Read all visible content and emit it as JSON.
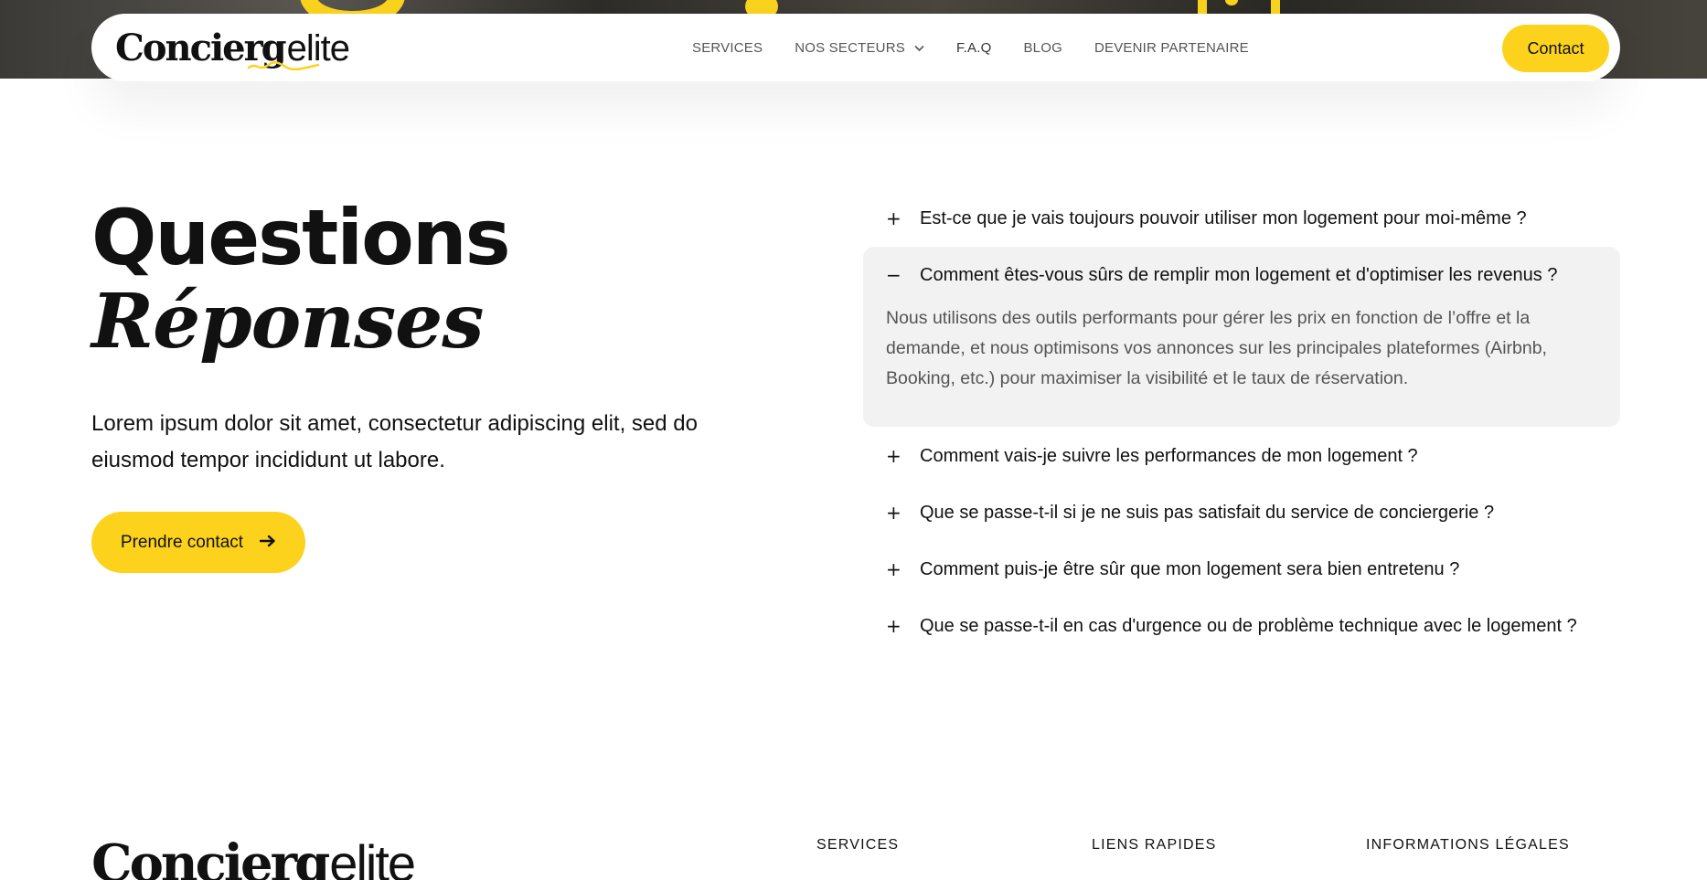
{
  "colors": {
    "accent": "#fcd21d",
    "open_panel_bg": "#f2f2f2",
    "text": "#111111",
    "muted": "#555555"
  },
  "brand": {
    "part1": "Concierg",
    "part2": "elite"
  },
  "nav": {
    "items": [
      {
        "label": "SERVICES"
      },
      {
        "label": "NOS SECTEURS"
      },
      {
        "label": "F.A.Q"
      },
      {
        "label": "BLOG"
      },
      {
        "label": "DEVENIR PARTENAIRE"
      }
    ],
    "contact_label": "Contact"
  },
  "faq": {
    "title_line1": "Questions",
    "title_line2": "Réponses",
    "lead": "Lorem ipsum dolor sit amet, consectetur adipiscing elit, sed do eiusmod tempor incididunt ut labore.",
    "cta_label": "Prendre contact",
    "items": [
      {
        "sign": "+",
        "question": "Est-ce que je vais toujours pouvoir utiliser mon logement pour moi-même ?"
      },
      {
        "sign": "−",
        "question": "Comment êtes-vous sûrs de remplir mon logement et d'optimiser les revenus ?",
        "answer": "Nous utilisons des outils performants pour gérer les prix en fonction de l’offre et la demande, et nous optimisons vos annonces sur les principales plateformes (Airbnb, Booking, etc.) pour maximiser la visibilité et le taux de réservation."
      },
      {
        "sign": "+",
        "question": "Comment vais-je suivre les performances de mon logement ?"
      },
      {
        "sign": "+",
        "question": "Que se passe-t-il si je ne suis pas satisfait du service de conciergerie ?"
      },
      {
        "sign": "+",
        "question": "Comment puis-je être sûr que mon logement sera bien entretenu ?"
      },
      {
        "sign": "+",
        "question": "Que se passe-t-il en cas d'urgence ou de problème technique avec le logement ?"
      }
    ]
  },
  "footer": {
    "columns": [
      "SERVICES",
      "LIENS RAPIDES",
      "INFORMATIONS LÉGALES"
    ]
  }
}
